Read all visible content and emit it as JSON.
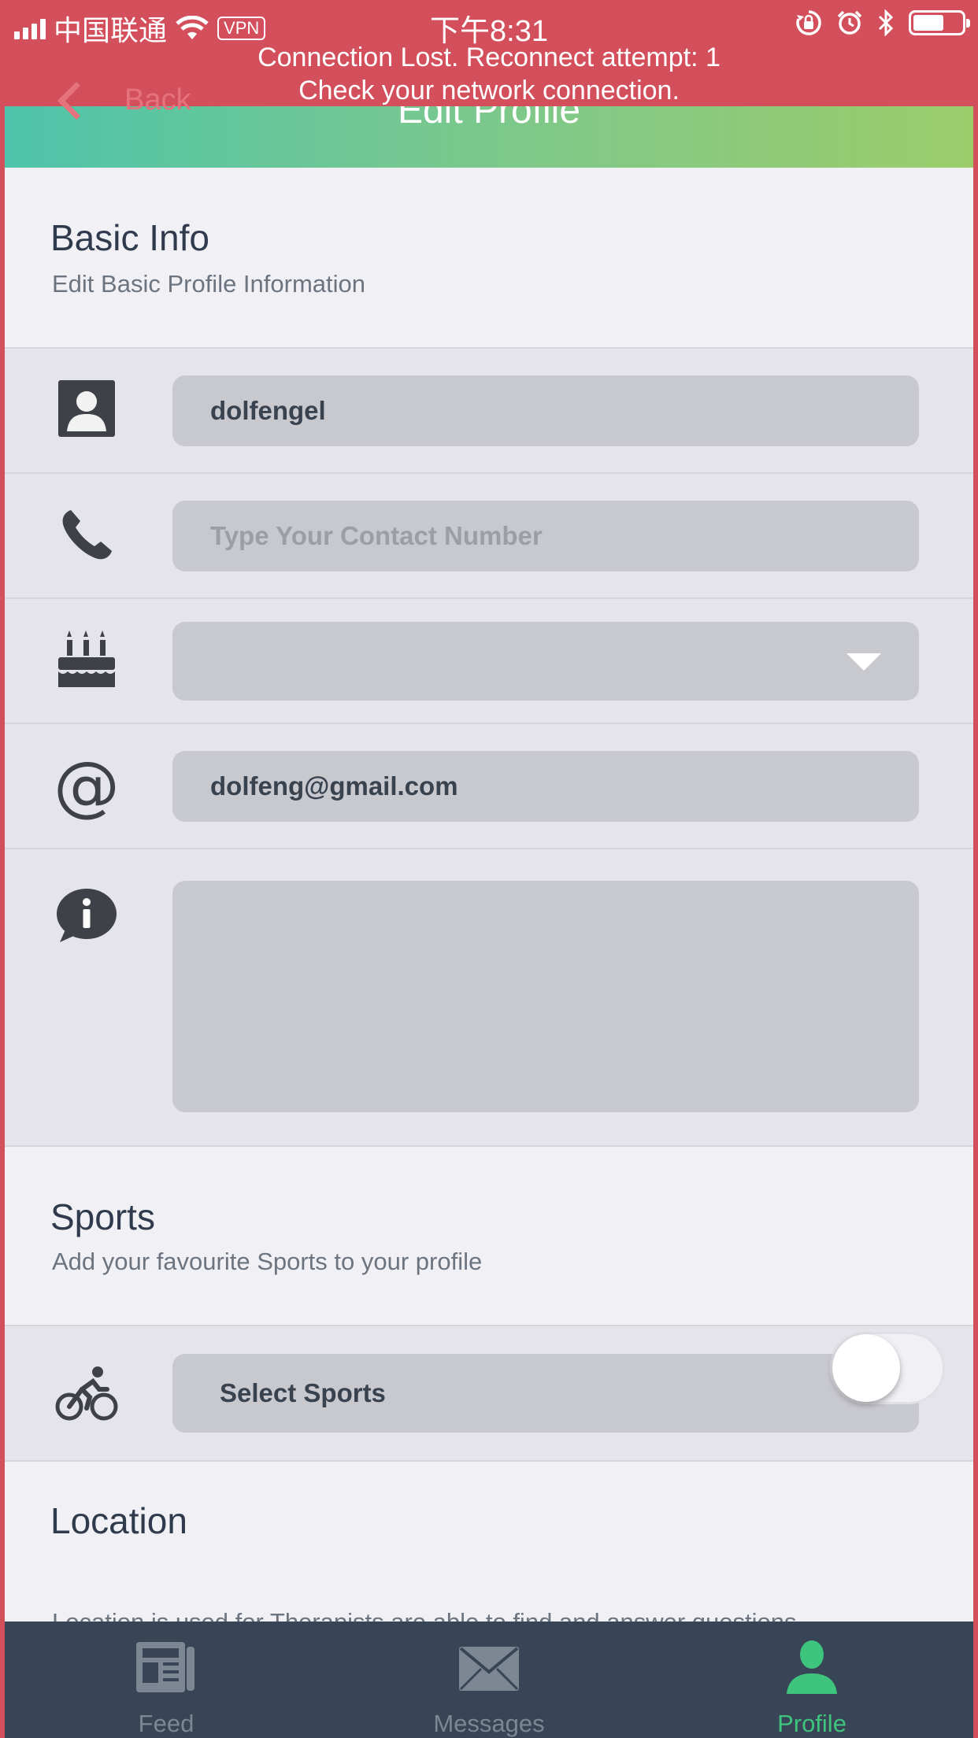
{
  "status_bar": {
    "carrier": "中国联通",
    "vpn": "VPN",
    "time": "下午8:31"
  },
  "connection_banner": {
    "line1": "Connection Lost. Reconnect attempt: 1",
    "line2": "Check your network connection."
  },
  "nav": {
    "title": "Edit Profile",
    "back_label": "Back"
  },
  "basic_info": {
    "title": "Basic Info",
    "subtitle": "Edit Basic Profile Information",
    "username_value": "dolfengel",
    "phone_placeholder": "Type Your Contact Number",
    "birthday_value": "",
    "email_value": "dolfeng@gmail.com",
    "about_value": ""
  },
  "sports": {
    "title": "Sports",
    "subtitle": "Add your favourite Sports to your profile",
    "select_label": "Select Sports"
  },
  "location": {
    "title": "Location",
    "description": "Location is used for Therapists are able to find and answer questions",
    "toggle_on": false
  },
  "tabs": [
    {
      "label": "Feed",
      "icon": "newspaper-icon",
      "active": false
    },
    {
      "label": "Messages",
      "icon": "envelope-icon",
      "active": false
    },
    {
      "label": "Profile",
      "icon": "person-icon",
      "active": true
    }
  ],
  "colors": {
    "status_bar_bg": "#d34f5c",
    "header_gradient_start": "#4ec4aa",
    "header_gradient_end": "#9ccc6a",
    "tabbar_bg": "#374556",
    "active_tab": "#3ec47d"
  }
}
